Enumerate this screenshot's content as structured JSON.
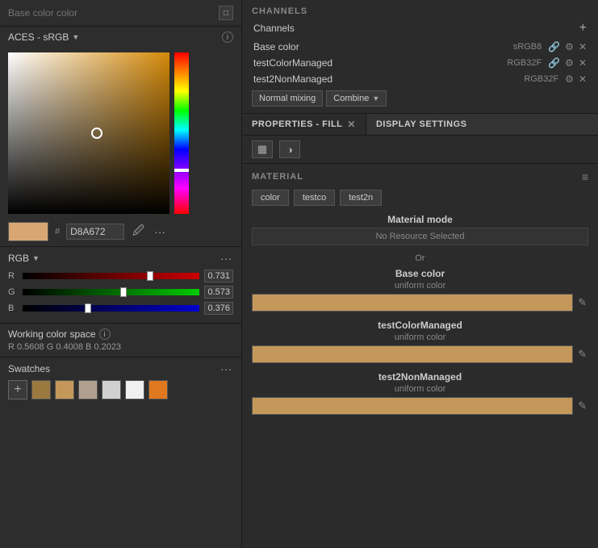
{
  "left": {
    "title_placeholder": "Base color color",
    "expand_btn": "□",
    "color_space": "ACES - sRGB",
    "hex_value": "D8A672",
    "hex_label": "#",
    "r_value": "0.731",
    "g_value": "0.573",
    "b_value": "0.376",
    "r_thumb_pct": "72",
    "g_thumb_pct": "57",
    "b_thumb_pct": "37",
    "working_cs_title": "Working color space",
    "working_cs_values": "R 0.5608   G 0.4008   B 0.2023",
    "swatches_label": "Swatches",
    "swatch_colors": [
      "#9b7a40",
      "#c4985a",
      "#b0a090",
      "#d0d0d0",
      "#f0f0f0",
      "#e07820"
    ]
  },
  "right": {
    "channels_title": "CHANNELS",
    "channels_header": "Channels",
    "channels": [
      {
        "name": "Base color",
        "type": "sRGB8",
        "has_link": true,
        "has_settings": true,
        "has_close": true
      },
      {
        "name": "testColorManaged",
        "type": "RGB32F",
        "has_link": true,
        "has_settings": true,
        "has_close": true
      },
      {
        "name": "test2NonManaged",
        "type": "RGB32F",
        "has_settings": true,
        "has_close": true
      }
    ],
    "mix_label": "Normal mixing",
    "combine_label": "Combine",
    "props_tab_label": "PROPERTIES - FILL",
    "display_settings_label": "DISPLAY SETTINGS",
    "material_title": "MATERIAL",
    "chips": [
      "color",
      "testco",
      "test2n"
    ],
    "material_mode_label": "Material mode",
    "material_mode_value": "No Resource Selected",
    "or_label": "Or",
    "base_color_label": "Base color",
    "base_color_sub": "uniform color",
    "test_color_managed_label": "testColorManaged",
    "test_color_managed_sub": "uniform color",
    "test2non_label": "test2NonManaged",
    "test2non_sub": "uniform color"
  }
}
